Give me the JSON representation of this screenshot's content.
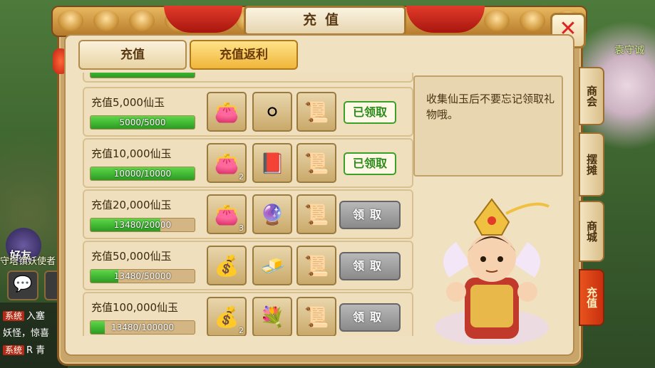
{
  "window": {
    "title": "充值",
    "close_icon": "close-icon"
  },
  "tabs": [
    {
      "label": "充值",
      "active": false
    },
    {
      "label": "充值返利",
      "active": true
    }
  ],
  "rows": [
    {
      "label": "充值5,000仙玉",
      "progress": "5000/5000",
      "fraction": 1.0,
      "items": [
        {
          "icon": "purple-bag-icon",
          "count": ""
        },
        {
          "icon": "snowball-icon",
          "count": ""
        },
        {
          "icon": "scroll-icon",
          "count": ""
        }
      ],
      "button": "已领取",
      "claimed": true
    },
    {
      "label": "充值10,000仙玉",
      "progress": "10000/10000",
      "fraction": 1.0,
      "items": [
        {
          "icon": "purple-bag-icon",
          "count": "2"
        },
        {
          "icon": "red-book-icon",
          "count": ""
        },
        {
          "icon": "scroll-icon",
          "count": ""
        }
      ],
      "button": "已领取",
      "claimed": true
    },
    {
      "label": "充值20,000仙玉",
      "progress": "13480/20000",
      "fraction": 0.674,
      "items": [
        {
          "icon": "purple-bag-icon",
          "count": "3"
        },
        {
          "icon": "crystal-ball-icon",
          "count": ""
        },
        {
          "icon": "scroll-icon",
          "count": ""
        }
      ],
      "button": "领取",
      "claimed": false
    },
    {
      "label": "充值50,000仙玉",
      "progress": "13480/50000",
      "fraction": 0.27,
      "items": [
        {
          "icon": "gold-bag-icon",
          "count": ""
        },
        {
          "icon": "gold-ingot-icon",
          "count": ""
        },
        {
          "icon": "scroll-icon",
          "count": ""
        }
      ],
      "button": "领取",
      "claimed": false
    },
    {
      "label": "充值100,000仙玉",
      "progress": "13480/100000",
      "fraction": 0.135,
      "items": [
        {
          "icon": "gold-bag-icon",
          "count": "2"
        },
        {
          "icon": "flower-basket-icon",
          "count": ""
        },
        {
          "icon": "scroll-icon",
          "count": ""
        }
      ],
      "button": "领取",
      "claimed": false
    }
  ],
  "tip": "收集仙玉后不要忘记领取礼物哦。",
  "side_tabs": [
    {
      "label": "商会",
      "active": false
    },
    {
      "label": "摆摊",
      "active": false
    },
    {
      "label": "商城",
      "active": false
    },
    {
      "label": "充值",
      "active": true
    }
  ],
  "background": {
    "city_label": "袁守诚",
    "friend_label": "好友",
    "npc_label": "守塔镇妖使者",
    "chat": [
      {
        "tag": "系统",
        "text": "入塞"
      },
      {
        "tag": "",
        "text": "妖怪，惊喜"
      },
      {
        "tag": "系统",
        "text": "R 青"
      }
    ]
  },
  "colors": {
    "claimed_green": "#2a8a1a",
    "progress_green": "#3ab82a",
    "active_tab": "#f0b63a",
    "active_side_tab": "#c8300e"
  }
}
